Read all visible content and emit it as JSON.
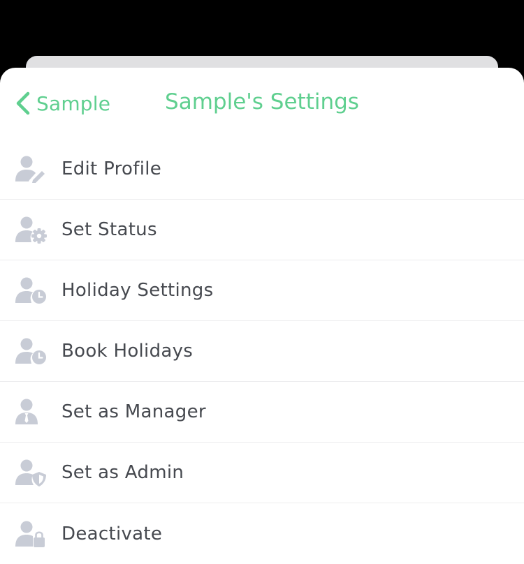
{
  "colors": {
    "accent": "#5fcf8f",
    "icon": "#c8ccd6",
    "text": "#46494f"
  },
  "header": {
    "back_label": "Sample",
    "title": "Sample's Settings"
  },
  "menu": {
    "items": [
      {
        "label": "Edit Profile",
        "icon": "user-edit-icon"
      },
      {
        "label": "Set Status",
        "icon": "user-gear-icon"
      },
      {
        "label": "Holiday Settings",
        "icon": "user-clock-icon"
      },
      {
        "label": "Book Holidays",
        "icon": "user-clock-icon"
      },
      {
        "label": "Set as Manager",
        "icon": "user-tie-icon"
      },
      {
        "label": "Set as Admin",
        "icon": "user-shield-icon"
      },
      {
        "label": "Deactivate",
        "icon": "user-lock-icon"
      }
    ]
  }
}
